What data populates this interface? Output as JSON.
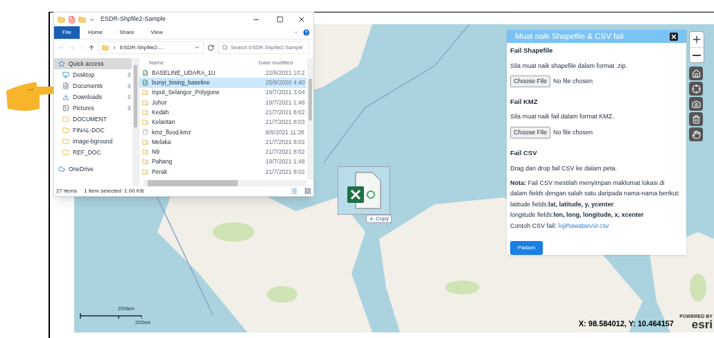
{
  "explorer": {
    "title": "ESDR-Shpfile2-Sample",
    "ribbon_tabs": [
      {
        "label": "File",
        "selected": true
      },
      {
        "label": "Home",
        "selected": false
      },
      {
        "label": "Share",
        "selected": false
      },
      {
        "label": "View",
        "selected": false
      }
    ],
    "address": "ESDR-Shpfile2-...",
    "search": {
      "placeholder": "Search ESDR-Shpfile2-Sample"
    },
    "nav": [
      {
        "label": "Quick access",
        "kind": "star",
        "selected": true,
        "pinned": false
      },
      {
        "label": "Desktop",
        "kind": "desktop",
        "selected": false,
        "pinned": true
      },
      {
        "label": "Documents",
        "kind": "documents",
        "selected": false,
        "pinned": true
      },
      {
        "label": "Downloads",
        "kind": "downloads",
        "selected": false,
        "pinned": true
      },
      {
        "label": "Pictures",
        "kind": "pictures",
        "selected": false,
        "pinned": true
      },
      {
        "label": "DOCUMENT",
        "kind": "folder",
        "selected": false,
        "pinned": false
      },
      {
        "label": "FINAL-DOC",
        "kind": "folder",
        "selected": false,
        "pinned": false
      },
      {
        "label": "image-bground",
        "kind": "folder",
        "selected": false,
        "pinned": false
      },
      {
        "label": "REF_DOC",
        "kind": "folder",
        "selected": false,
        "pinned": false
      },
      {
        "label": "OneDrive",
        "kind": "cloud",
        "selected": false,
        "pinned": false
      }
    ],
    "columns": [
      "Name",
      "Date modified"
    ],
    "files": [
      {
        "name": "BASELINE_UDARA_1U",
        "date": "22/6/2021 10:2",
        "kind": "csv",
        "selected": false
      },
      {
        "name": "bunyi_bising_baseline",
        "date": "25/9/2020 4:40",
        "kind": "csv",
        "selected": true
      },
      {
        "name": "Input_Selangor_Polygone",
        "date": "19/7/2021 3:04",
        "kind": "zip",
        "selected": false
      },
      {
        "name": "Johor",
        "date": "19/7/2021 1:48",
        "kind": "zip",
        "selected": false
      },
      {
        "name": "Kedah",
        "date": "21/7/2021 8:02",
        "kind": "zip",
        "selected": false
      },
      {
        "name": "Kelantan",
        "date": "21/7/2021 8:03",
        "kind": "zip",
        "selected": false
      },
      {
        "name": "kmz_flood.kmz",
        "date": "8/6/2021 11:28",
        "kind": "file",
        "selected": false
      },
      {
        "name": "Melaka",
        "date": "21/7/2021 8:02",
        "kind": "zip",
        "selected": false
      },
      {
        "name": "N9",
        "date": "21/7/2021 8:02",
        "kind": "zip",
        "selected": false
      },
      {
        "name": "Pahang",
        "date": "19/7/2021 1:48",
        "kind": "zip",
        "selected": false
      },
      {
        "name": "Perak",
        "date": "21/7/2021 8:02",
        "kind": "zip",
        "selected": false
      }
    ],
    "status": [
      "27 items",
      "1 item selected",
      "1.00 KB"
    ]
  },
  "drag": {
    "badge": "Copy"
  },
  "panel": {
    "title": "Muat naik Shapefile & CSV fail",
    "sections": [
      {
        "kind": "upload",
        "heading": "Fail Shapefile",
        "text": "Sila muat naik shapefile dalam format .zip.",
        "button": "Choose File",
        "status": "No file chosen"
      },
      {
        "kind": "upload",
        "heading": "Fail KMZ",
        "text": "Sila muat naik fail dalam format KMZ.",
        "button": "Choose File",
        "status": "No file chosen"
      },
      {
        "kind": "note",
        "heading": "Fail CSV",
        "text": "Drag dan drop fail CSV ke dalam peta.",
        "lines": [
          "**Nota:** Fail CSV mestilah menyimpan maklumat lokasi di dalam *fields* dengan salah satu daripada nama-nama berikut:",
          "latitude fields:**lat, latitude, y, ycenter**",
          "longitude fields:**lon, long, longitude, x, xcenter**"
        ],
        "example_label": "Contoh CSV fail:",
        "example_link": "lojiRawatanAir.csv"
      }
    ],
    "button": "Padam"
  },
  "map": {
    "scale": [
      "200km",
      "200mi"
    ],
    "coords": "X: 98.584012, Y: 10.464157",
    "attribution": [
      "POWERED BY",
      "esri"
    ]
  }
}
